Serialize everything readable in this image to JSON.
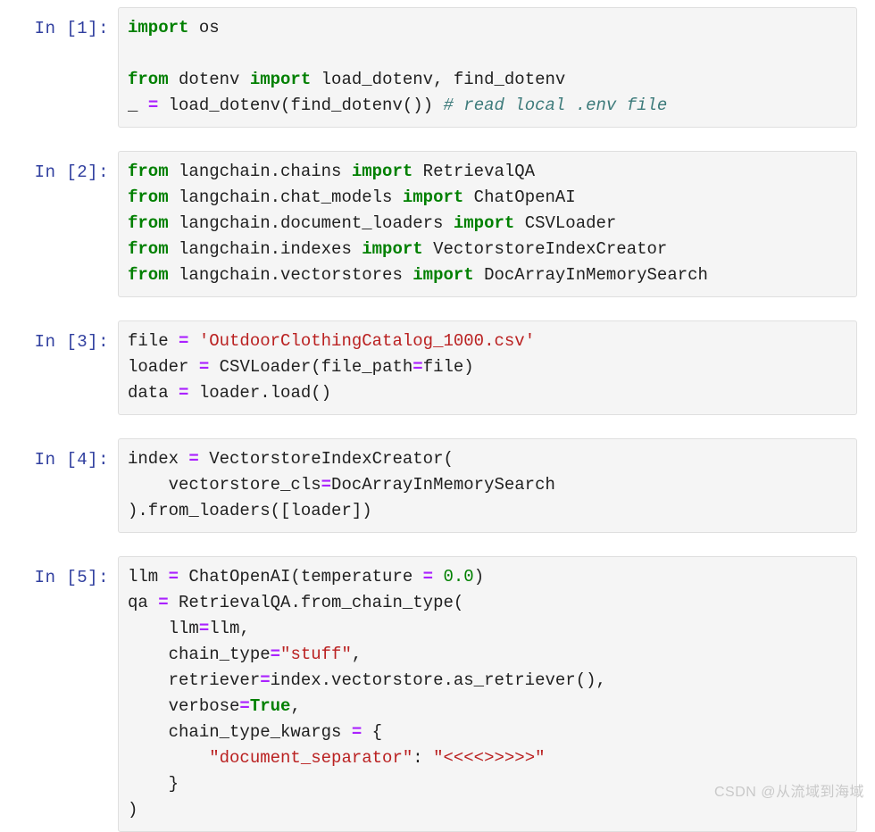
{
  "notebook": {
    "cells": [
      {
        "prompt": "In [1]:",
        "lines": [
          [
            {
              "t": "import",
              "c": "k"
            },
            {
              "t": " os",
              "c": "n"
            }
          ],
          [
            {
              "t": "",
              "c": "n"
            }
          ],
          [
            {
              "t": "from",
              "c": "k"
            },
            {
              "t": " dotenv ",
              "c": "n"
            },
            {
              "t": "import",
              "c": "k"
            },
            {
              "t": " load_dotenv, find_dotenv",
              "c": "n"
            }
          ],
          [
            {
              "t": "_ ",
              "c": "n"
            },
            {
              "t": "=",
              "c": "o"
            },
            {
              "t": " load_dotenv(find_dotenv()) ",
              "c": "n"
            },
            {
              "t": "# read local .env file",
              "c": "c"
            }
          ]
        ]
      },
      {
        "prompt": "In [2]:",
        "lines": [
          [
            {
              "t": "from",
              "c": "k"
            },
            {
              "t": " langchain.chains ",
              "c": "n"
            },
            {
              "t": "import",
              "c": "k"
            },
            {
              "t": " RetrievalQA",
              "c": "n"
            }
          ],
          [
            {
              "t": "from",
              "c": "k"
            },
            {
              "t": " langchain.chat_models ",
              "c": "n"
            },
            {
              "t": "import",
              "c": "k"
            },
            {
              "t": " ChatOpenAI",
              "c": "n"
            }
          ],
          [
            {
              "t": "from",
              "c": "k"
            },
            {
              "t": " langchain.document_loaders ",
              "c": "n"
            },
            {
              "t": "import",
              "c": "k"
            },
            {
              "t": " CSVLoader",
              "c": "n"
            }
          ],
          [
            {
              "t": "from",
              "c": "k"
            },
            {
              "t": " langchain.indexes ",
              "c": "n"
            },
            {
              "t": "import",
              "c": "k"
            },
            {
              "t": " VectorstoreIndexCreator",
              "c": "n"
            }
          ],
          [
            {
              "t": "from",
              "c": "k"
            },
            {
              "t": " langchain.vectorstores ",
              "c": "n"
            },
            {
              "t": "import",
              "c": "k"
            },
            {
              "t": " DocArrayInMemorySearch",
              "c": "n"
            }
          ]
        ]
      },
      {
        "prompt": "In [3]:",
        "lines": [
          [
            {
              "t": "file ",
              "c": "n"
            },
            {
              "t": "=",
              "c": "o"
            },
            {
              "t": " ",
              "c": "n"
            },
            {
              "t": "'OutdoorClothingCatalog_1000.csv'",
              "c": "s"
            }
          ],
          [
            {
              "t": "loader ",
              "c": "n"
            },
            {
              "t": "=",
              "c": "o"
            },
            {
              "t": " CSVLoader(file_path",
              "c": "n"
            },
            {
              "t": "=",
              "c": "o"
            },
            {
              "t": "file)",
              "c": "n"
            }
          ],
          [
            {
              "t": "data ",
              "c": "n"
            },
            {
              "t": "=",
              "c": "o"
            },
            {
              "t": " loader.load()",
              "c": "n"
            }
          ]
        ]
      },
      {
        "prompt": "In [4]:",
        "lines": [
          [
            {
              "t": "index ",
              "c": "n"
            },
            {
              "t": "=",
              "c": "o"
            },
            {
              "t": " VectorstoreIndexCreator(",
              "c": "n"
            }
          ],
          [
            {
              "t": "    vectorstore_cls",
              "c": "n"
            },
            {
              "t": "=",
              "c": "o"
            },
            {
              "t": "DocArrayInMemorySearch",
              "c": "n"
            }
          ],
          [
            {
              "t": ").from_loaders([loader])",
              "c": "n"
            }
          ]
        ]
      },
      {
        "prompt": "In [5]:",
        "lines": [
          [
            {
              "t": "llm ",
              "c": "n"
            },
            {
              "t": "=",
              "c": "o"
            },
            {
              "t": " ChatOpenAI(temperature ",
              "c": "n"
            },
            {
              "t": "=",
              "c": "o"
            },
            {
              "t": " ",
              "c": "n"
            },
            {
              "t": "0.0",
              "c": "m"
            },
            {
              "t": ")",
              "c": "n"
            }
          ],
          [
            {
              "t": "qa ",
              "c": "n"
            },
            {
              "t": "=",
              "c": "o"
            },
            {
              "t": " RetrievalQA.from_chain_type(",
              "c": "n"
            }
          ],
          [
            {
              "t": "    llm",
              "c": "n"
            },
            {
              "t": "=",
              "c": "o"
            },
            {
              "t": "llm,",
              "c": "n"
            }
          ],
          [
            {
              "t": "    chain_type",
              "c": "n"
            },
            {
              "t": "=",
              "c": "o"
            },
            {
              "t": "\"stuff\"",
              "c": "s"
            },
            {
              "t": ",",
              "c": "n"
            }
          ],
          [
            {
              "t": "    retriever",
              "c": "n"
            },
            {
              "t": "=",
              "c": "o"
            },
            {
              "t": "index.vectorstore.as_retriever(),",
              "c": "n"
            }
          ],
          [
            {
              "t": "    verbose",
              "c": "n"
            },
            {
              "t": "=",
              "c": "o"
            },
            {
              "t": "True",
              "c": "kc"
            },
            {
              "t": ",",
              "c": "n"
            }
          ],
          [
            {
              "t": "    chain_type_kwargs ",
              "c": "n"
            },
            {
              "t": "=",
              "c": "o"
            },
            {
              "t": " {",
              "c": "n"
            }
          ],
          [
            {
              "t": "        ",
              "c": "n"
            },
            {
              "t": "\"document_separator\"",
              "c": "s"
            },
            {
              "t": ": ",
              "c": "n"
            },
            {
              "t": "\"<<<<>>>>>\"",
              "c": "s"
            }
          ],
          [
            {
              "t": "    }",
              "c": "n"
            }
          ],
          [
            {
              "t": ")",
              "c": "n"
            }
          ]
        ]
      }
    ]
  },
  "watermark": {
    "text": "CSDN @从流域到海域"
  },
  "colors": {
    "prompt": "#303f9f",
    "cell_background": "#f5f5f5",
    "cell_border": "#dfdfdf",
    "keyword": "#008000",
    "operator": "#aa22ff",
    "string": "#ba2121",
    "number": "#008000",
    "comment": "#3d7b7b",
    "text": "#202020",
    "watermark": "#c9c9c9"
  }
}
